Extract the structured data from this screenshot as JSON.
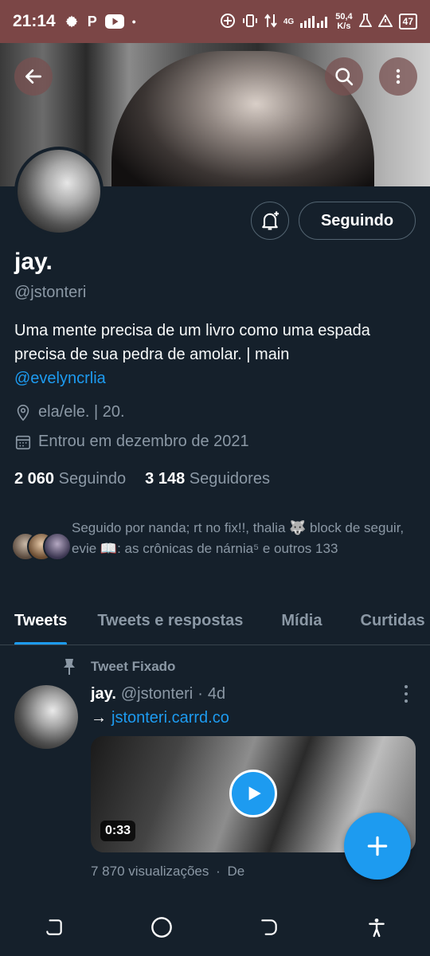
{
  "status_bar": {
    "time": "21:14",
    "left_icons": [
      "gear-icon",
      "p-app-icon",
      "youtube-icon",
      "dot-icon"
    ],
    "p_glyph": "P",
    "dot_glyph": "•",
    "network_type": "4G",
    "net_speed_value": "50,4",
    "net_speed_unit": "K/s",
    "battery": "47"
  },
  "header": {
    "back_icon": "arrow-left-icon",
    "search_icon": "search-icon",
    "more_icon": "more-vertical-icon"
  },
  "profile": {
    "name": "jay.",
    "handle": "@jstonteri",
    "bio_text": "Uma mente precisa de um livro como uma espada precisa de sua pedra de amolar. | main",
    "bio_mention": "@evelyncrlia",
    "location": "ela/ele. | 20.",
    "joined": "Entrou em dezembro de 2021",
    "following_count": "2 060",
    "following_label": "Seguindo",
    "followers_count": "3 148",
    "followers_label": "Seguidores",
    "followed_by": "Seguido por nanda; rt no fix!!, thalia 🐺 block de seguir, evie 📖: as crônicas de nárnia⁵ e outros 133",
    "follow_button": "Seguindo"
  },
  "tabs": [
    {
      "label": "Tweets",
      "active": true
    },
    {
      "label": "Tweets e respostas",
      "active": false
    },
    {
      "label": "Mídia",
      "active": false
    },
    {
      "label": "Curtidas",
      "active": false
    }
  ],
  "tweet": {
    "pinned_label": "Tweet Fixado",
    "author_name": "jay.",
    "author_handle": "@jstonteri",
    "separator": "·",
    "time": "4d",
    "arrow": "→",
    "link": "jstonteri.carrd.co",
    "video_duration": "0:33",
    "views": "7 870 visualizações",
    "views_suffix": "De"
  },
  "colors": {
    "background": "#15202b",
    "accent": "#1d9bf0",
    "status_bar": "#7b4646",
    "secondary_text": "#8b98a5"
  },
  "nav": [
    "recent-apps-icon",
    "home-icon",
    "back-icon",
    "accessibility-icon"
  ]
}
